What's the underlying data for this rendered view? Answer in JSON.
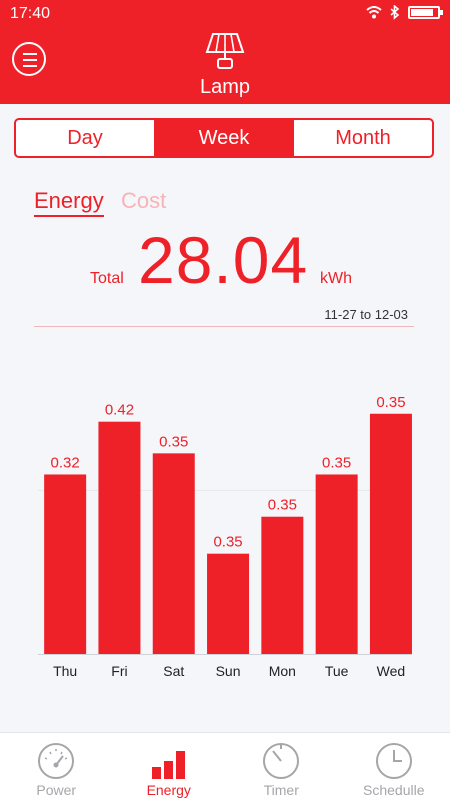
{
  "status_bar": {
    "time": "17:40",
    "battery_percent": 85
  },
  "header": {
    "title": "Lamp"
  },
  "period_tabs": {
    "items": [
      "Day",
      "Week",
      "Month"
    ],
    "selected": "Week"
  },
  "metric_tabs": {
    "items": [
      "Energy",
      "Cost"
    ],
    "selected": "Energy"
  },
  "total": {
    "label": "Total",
    "value": "28.04",
    "unit": "kWh"
  },
  "date_range": "11-27 to 12-03",
  "colors": {
    "accent": "#ee2129",
    "inactive": "#a4a6aa"
  },
  "chart_data": {
    "type": "bar",
    "categories": [
      "Thu",
      "Fri",
      "Sat",
      "Sun",
      "Mon",
      "Tue",
      "Wed"
    ],
    "values": [
      0.32,
      0.42,
      0.35,
      0.35,
      0.35,
      0.35,
      0.35
    ],
    "bar_fraction": [
      0.68,
      0.88,
      0.76,
      0.38,
      0.52,
      0.68,
      0.91
    ],
    "value_labels": [
      "0.32",
      "0.42",
      "0.35",
      "0.35",
      "0.35",
      "0.35",
      "0.35"
    ],
    "grid": true
  },
  "bottom_nav": {
    "items": [
      {
        "label": "Power",
        "icon": "gauge-icon"
      },
      {
        "label": "Energy",
        "icon": "bar-chart-icon"
      },
      {
        "label": "Timer",
        "icon": "timer-icon"
      },
      {
        "label": "Schedulle",
        "icon": "clock-icon"
      }
    ],
    "selected": "Energy"
  }
}
